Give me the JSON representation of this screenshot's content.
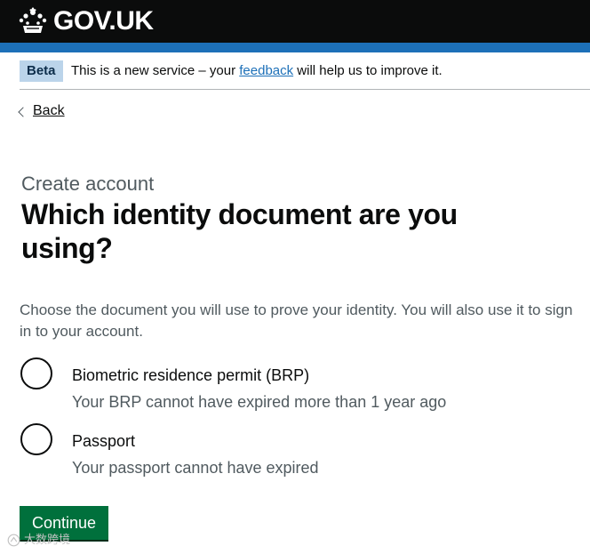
{
  "header": {
    "logo_text": "GOV.UK",
    "icon": "crown-icon",
    "brand_color": "#1d70b8"
  },
  "phase_banner": {
    "tag": "Beta",
    "text_before": "This is a new service – your ",
    "link": "feedback",
    "text_after": " will help us to improve it."
  },
  "navigation": {
    "back": "Back",
    "icon": "chevron-left-icon"
  },
  "form": {
    "caption": "Create account",
    "title": "Which identity document are you using?",
    "hint": "Choose the document you will use to prove your identity. You will also use it to sign in to your account.",
    "options": [
      {
        "label": "Biometric residence permit (BRP)",
        "hint": "Your BRP cannot have expired more than 1 year ago",
        "selected": false
      },
      {
        "label": "Passport",
        "hint": "Your passport cannot have expired",
        "selected": false
      }
    ],
    "continue": "Continue",
    "button_color": "#00703c"
  },
  "watermark": {
    "text": "大数跨境",
    "icon": "watermark-logo-icon"
  }
}
